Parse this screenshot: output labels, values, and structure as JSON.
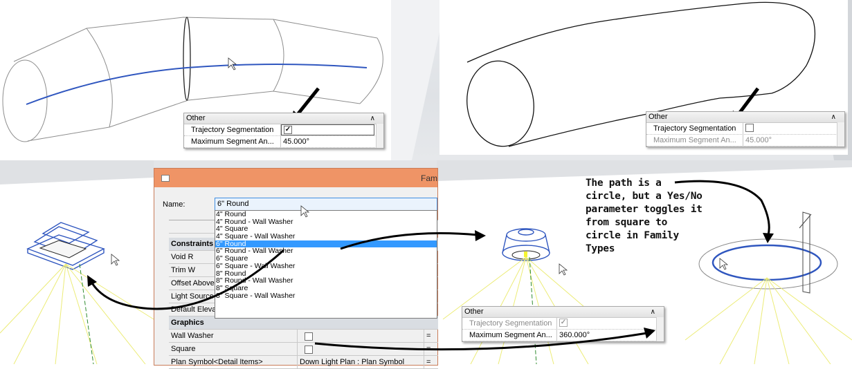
{
  "top_left_panel": {
    "section": "Other",
    "rows": [
      {
        "label": "Trajectory Segmentation",
        "checked": true
      },
      {
        "label": "Maximum Segment An...",
        "value": "45.000°"
      }
    ]
  },
  "top_right_panel": {
    "section": "Other",
    "rows": [
      {
        "label": "Trajectory Segmentation",
        "checked": false
      },
      {
        "label": "Maximum Segment An...",
        "value": "45.000°"
      }
    ]
  },
  "bottom_panel": {
    "section": "Other",
    "rows": [
      {
        "label": "Trajectory Segmentation",
        "checked": true
      },
      {
        "label": "Maximum Segment An...",
        "value": "360.000°"
      }
    ]
  },
  "dialog": {
    "title": "Fam",
    "name_label": "Name:",
    "name_value": "6\" Round",
    "types": [
      "4\" Round",
      "4\" Round - Wall Washer",
      "4\" Square",
      "4\" Square - Wall Washer",
      "6\" Round",
      "6\" Round - Wall Washer",
      "6\" Square",
      "6\" Square - Wall Washer",
      "8\" Round",
      "8\" Round - Wall Washer",
      "8\" Square",
      "8\" Square - Wall Washer"
    ],
    "selected_type": "6\" Round",
    "param_rows": [
      {
        "label": "Constraints",
        "group": true
      },
      {
        "label": "Void R"
      },
      {
        "label": "Trim W"
      },
      {
        "label": "Offset Above"
      },
      {
        "label": "Light Source"
      },
      {
        "label": "Default Eleva"
      },
      {
        "label": "Graphics",
        "group": true
      },
      {
        "label": "Wall Washer",
        "checkbox": true,
        "formula": "="
      },
      {
        "label": "Square",
        "checkbox": true,
        "formula": "="
      },
      {
        "label": "Plan Symbol<Detail Items>",
        "value": "Down Light Plan : Plan Symbol",
        "formula": "="
      }
    ]
  },
  "annotation": "The path is a circle, but a Yes/No parameter toggles it from square to circle in Family Types",
  "colors": {
    "dialog_title": "#ef9466",
    "selection": "#3399ff",
    "path_blue": "#2a4fb8",
    "light_rays": "#e8e86a"
  }
}
